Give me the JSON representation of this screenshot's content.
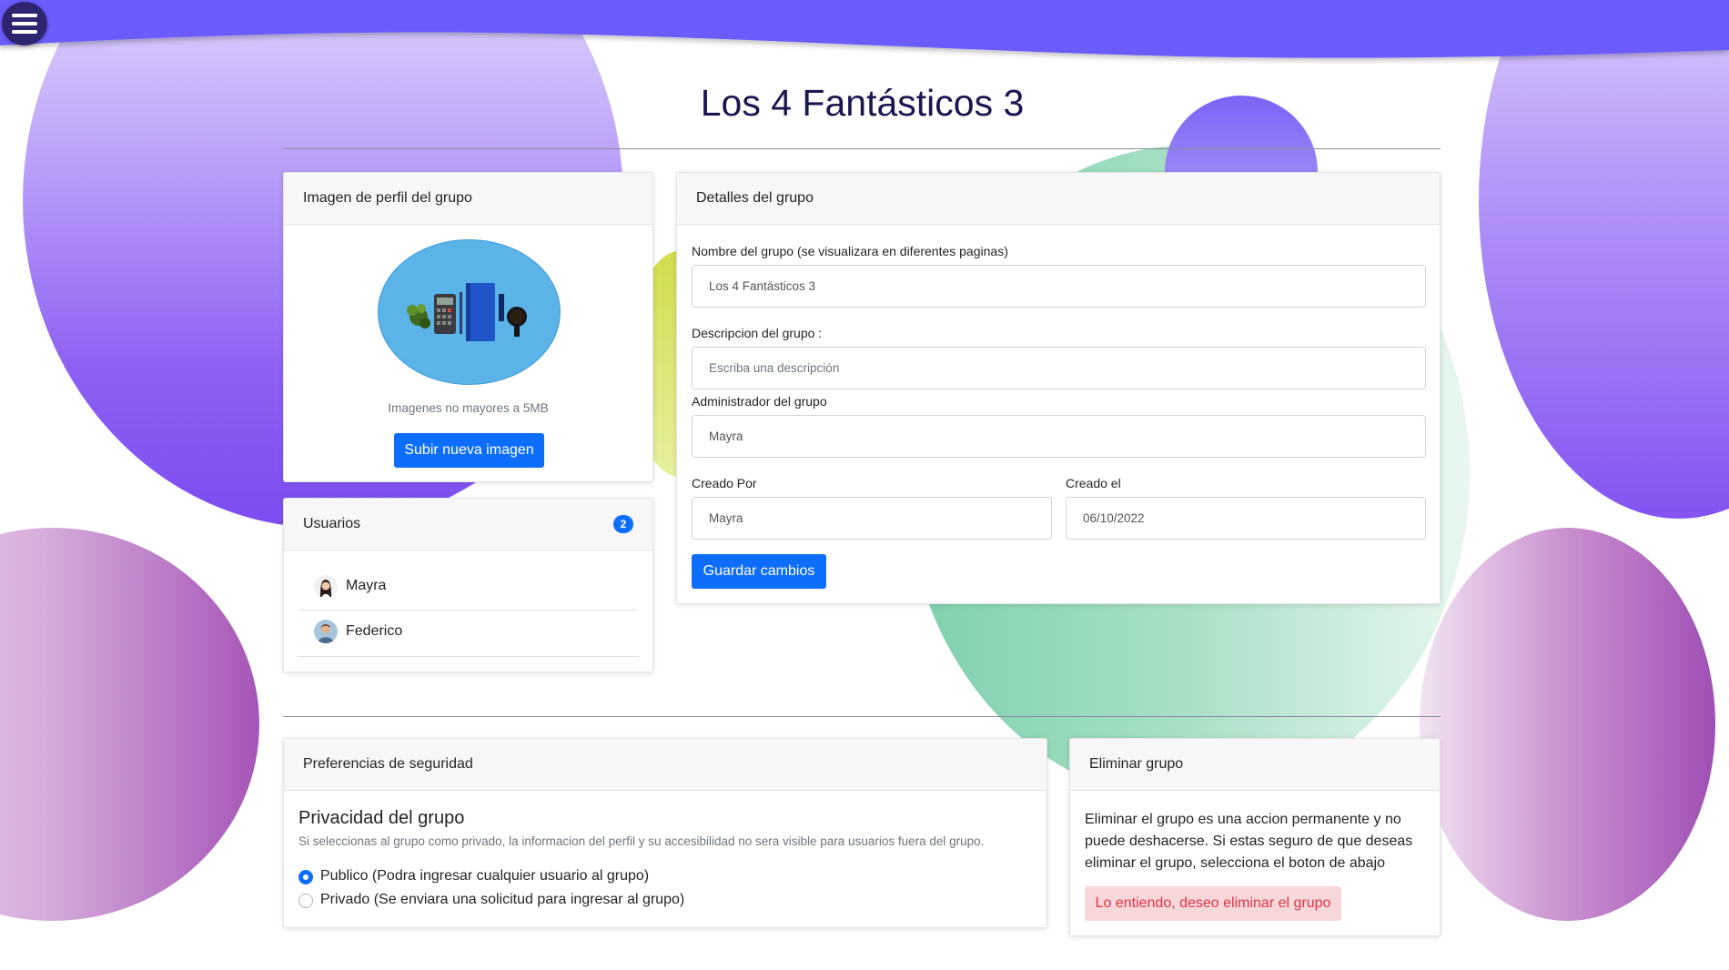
{
  "colors": {
    "accent": "#0d6efd",
    "header_wave": "#6a5cff",
    "menu_button": "#2d2570",
    "title": "#1a1750",
    "danger_bg": "#f8d7da",
    "danger_text": "#dc3545"
  },
  "menu": {
    "icon": "hamburger-menu-icon"
  },
  "page": {
    "title": "Los 4 Fantásticos 3"
  },
  "profile_image_card": {
    "header": "Imagen de perfil del grupo",
    "image_description": "group-profile-image",
    "hint": "Imagenes no mayores a 5MB",
    "upload_button": "Subir nueva imagen"
  },
  "users_card": {
    "header": "Usuarios",
    "count": "2",
    "users": [
      {
        "name": "Mayra",
        "avatar": "female-avatar"
      },
      {
        "name": "Federico",
        "avatar": "male-avatar"
      }
    ]
  },
  "details_card": {
    "header": "Detalles del grupo",
    "name_label": "Nombre del grupo (se visualizara en diferentes paginas)",
    "name_value": "Los 4 Fantásticos 3",
    "description_label": "Descripcion del grupo :",
    "description_placeholder": "Escriba una descripción",
    "admin_label": "Administrador del grupo",
    "admin_value": "Mayra",
    "created_by_label": "Creado Por",
    "created_by_value": "Mayra",
    "created_on_label": "Creado el",
    "created_on_value": "06/10/2022",
    "save_button": "Guardar cambios"
  },
  "security_card": {
    "header": "Preferencias de seguridad",
    "title": "Privacidad del grupo",
    "description": "Si seleccionas al grupo como privado, la informacion del perfil y su accesibilidad no sera visible para usuarios fuera del grupo.",
    "options": [
      {
        "label": "Publico (Podra ingresar cualquier usuario al grupo)",
        "selected": true
      },
      {
        "label": "Privado (Se enviara una solicitud para ingresar al grupo)",
        "selected": false
      }
    ]
  },
  "delete_card": {
    "header": "Eliminar grupo",
    "text": "Eliminar el grupo es una accion permanente y no puede deshacerse. Si estas seguro de que deseas eliminar el grupo, selecciona el boton de abajo",
    "button": "Lo entiendo, deseo eliminar el grupo"
  }
}
